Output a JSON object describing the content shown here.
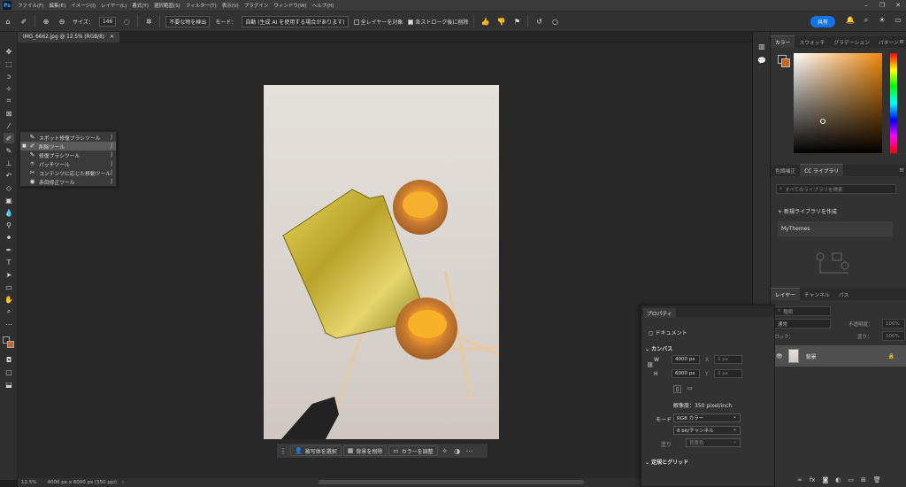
{
  "menubar": {
    "logo": "Ps",
    "items": [
      "ファイル(F)",
      "編集(E)",
      "イメージ(I)",
      "レイヤー(L)",
      "書式(Y)",
      "選択範囲(S)",
      "フィルター(T)",
      "表示(V)",
      "プラグイン",
      "ウィンドウ(W)",
      "ヘルプ(H)"
    ]
  },
  "options": {
    "size_label": "サイズ：",
    "size_value": "146",
    "detect_button": "不要な物を検出",
    "mode_label": "モード：",
    "mode_value": "自動 (生成 AI を使用する場合があります)",
    "all_layers": "全レイヤーを対象",
    "after_stroke": "各ストローク後に削除",
    "share": "共有"
  },
  "document": {
    "tab": "IMG_6662.jpg @ 12.5% (RGB/8)",
    "zoom": "12.5%",
    "info": "4000 px x 6000 px (350 ppi)"
  },
  "flyout": {
    "items": [
      {
        "label": "スポット修復ブラシツール",
        "key": "J",
        "icon": "spot-healing-brush-icon",
        "glyph": "✎"
      },
      {
        "label": "削除ツール",
        "key": "J",
        "icon": "remove-tool-icon",
        "glyph": "✐"
      },
      {
        "label": "修復ブラシツール",
        "key": "J",
        "icon": "healing-brush-icon",
        "glyph": "✎"
      },
      {
        "label": "パッチツール",
        "key": "J",
        "icon": "patch-tool-icon",
        "glyph": "⌾"
      },
      {
        "label": "コンテンツに応じた移動ツール",
        "key": "J",
        "icon": "content-aware-move-icon",
        "glyph": "✂"
      },
      {
        "label": "赤目修正ツール",
        "key": "J",
        "icon": "red-eye-icon",
        "glyph": "◉"
      }
    ]
  },
  "contextbar": {
    "select_subject": "被写体を選択",
    "remove_bg": "背景を削除",
    "adjust_color": "カラーを調整"
  },
  "colorpanel": {
    "tabs": [
      "カラー",
      "スウォッチ",
      "グラデーション",
      "パターン"
    ],
    "foreground": "#2a2a2a",
    "background": "#c8641e",
    "hue": "#f08a0e"
  },
  "library": {
    "tabs": [
      "色調補正",
      "CC ライブラリ"
    ],
    "search_placeholder": "すべてのライブラリを検索",
    "create": "新規ライブラリを作成",
    "item": "MyThemes"
  },
  "layers": {
    "tabs": [
      "レイヤー",
      "チャンネル",
      "パス"
    ],
    "kind": "種類",
    "blend": "通常",
    "opacity_label": "不透明度：",
    "opacity": "100%",
    "lock_label": "ロック：",
    "fill_label": "塗り：",
    "fill": "100%",
    "layer_name": "背景"
  },
  "properties": {
    "title": "プロパティ",
    "doc_label": "ドキュメント",
    "canvas_title": "カンバス",
    "w_label": "W",
    "w_value": "4000 px",
    "h_label": "H",
    "h_value": "6000 px",
    "x_label": "X",
    "x_value": "0 px",
    "y_label": "Y",
    "y_value": "0 px",
    "resolution": "解像度：350 pixel/inch",
    "mode_label": "モード",
    "mode_value": "RGB カラー",
    "bits_value": "8 bit/チャンネル",
    "fill_label": "塗り",
    "fill_value": "背景色",
    "rulers_title": "定規とグリッド"
  }
}
